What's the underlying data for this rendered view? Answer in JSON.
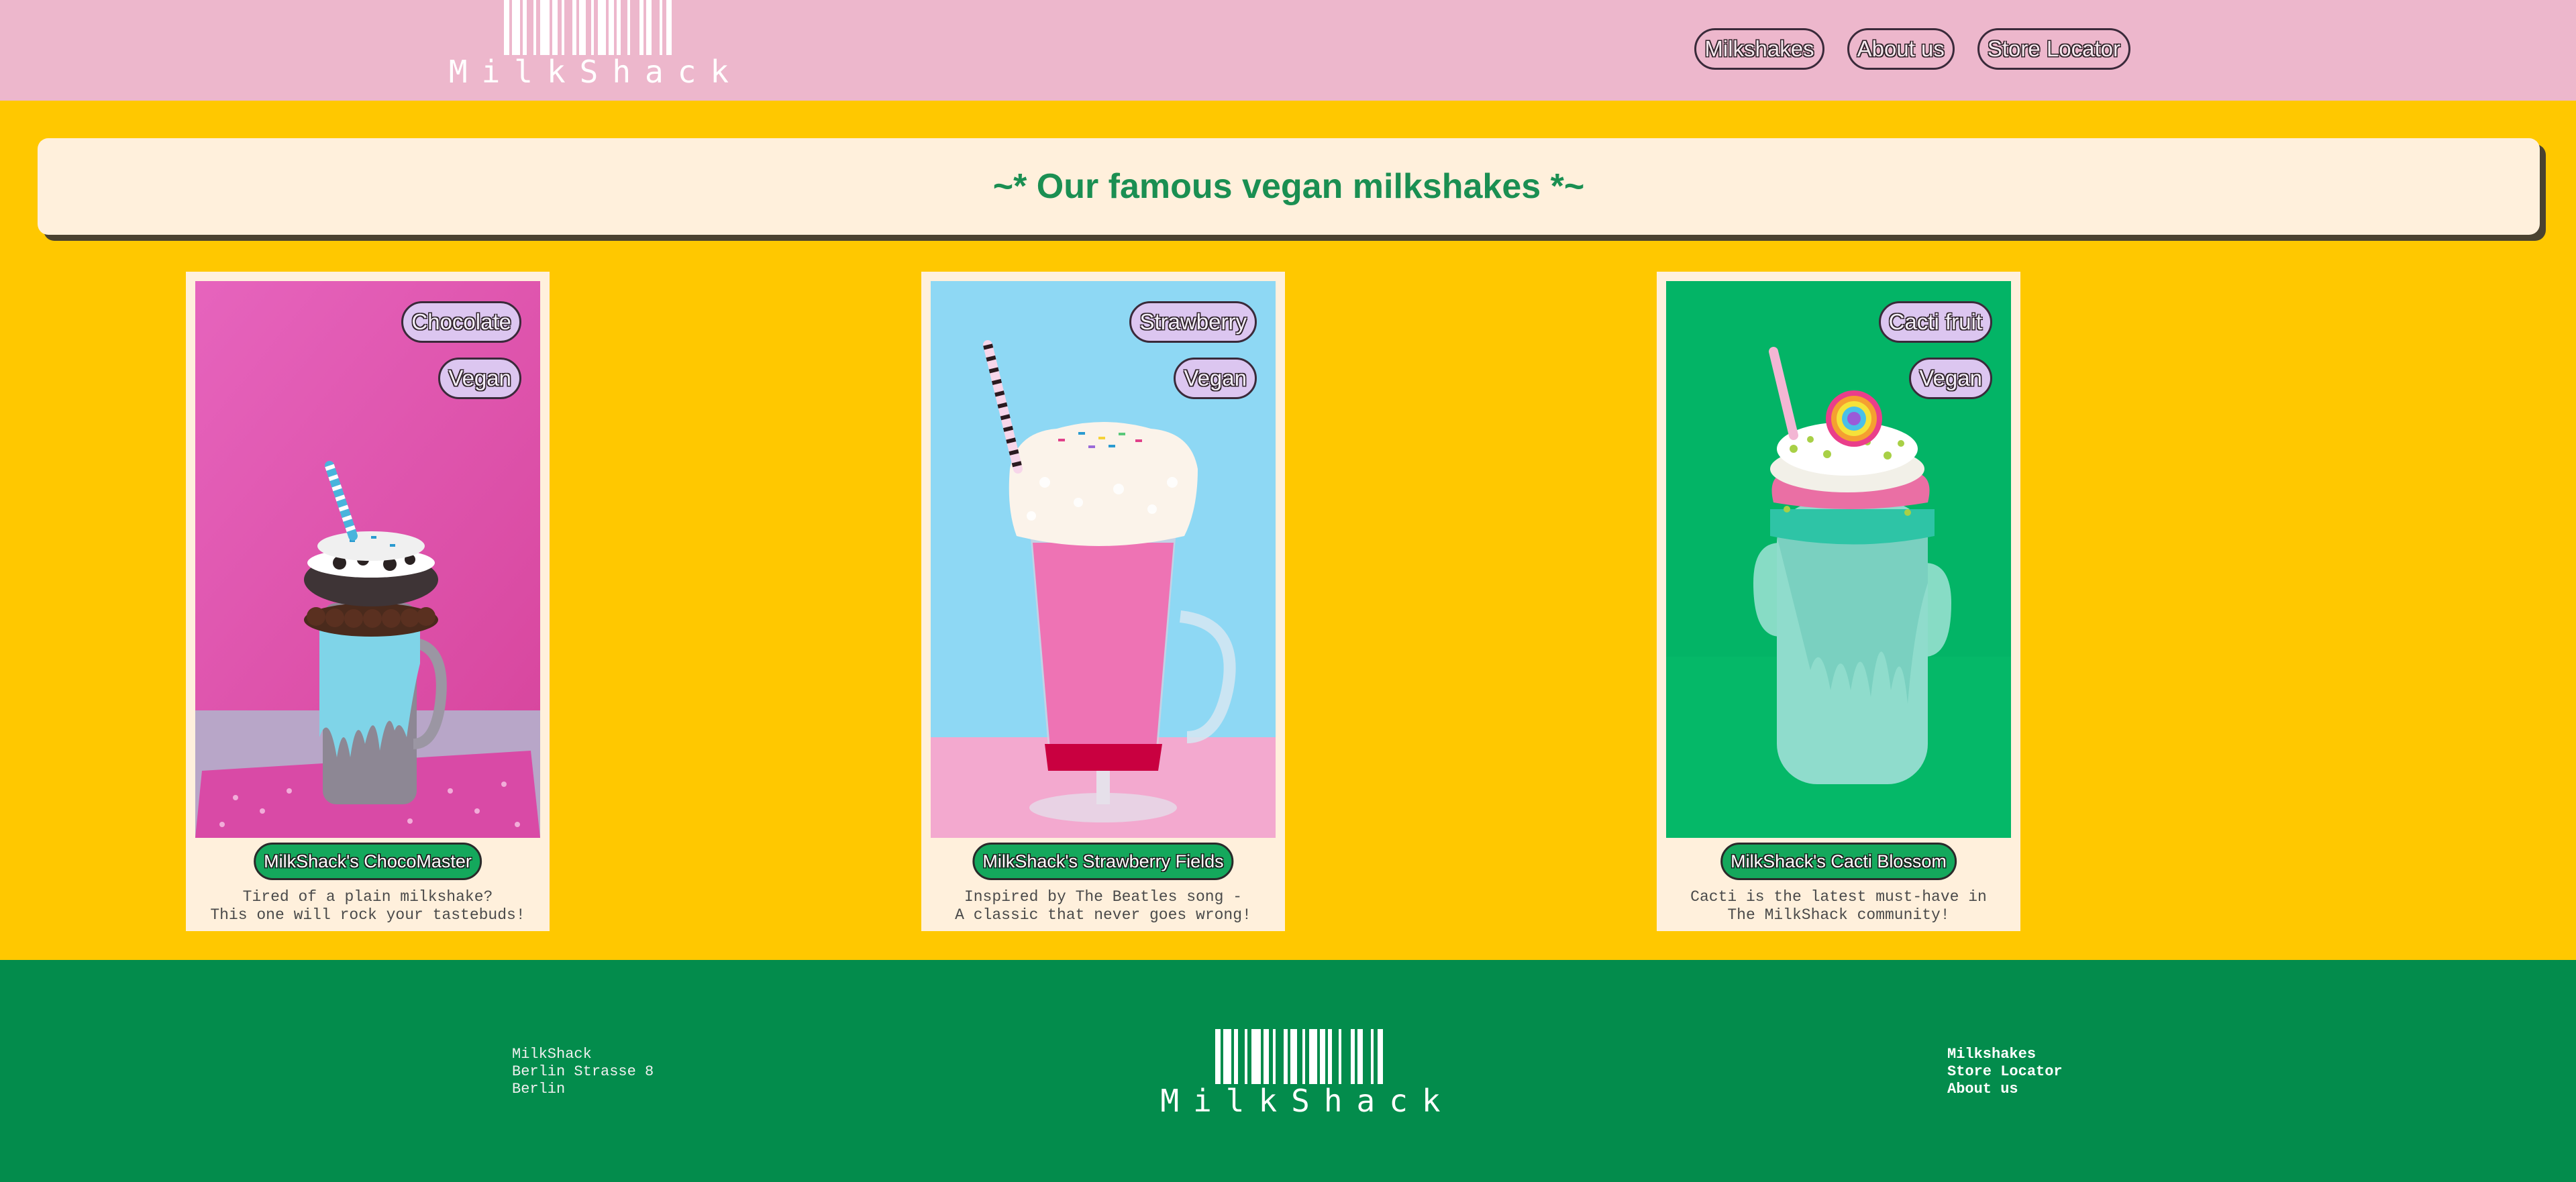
{
  "brand": {
    "name": "MilkShack"
  },
  "nav": {
    "items": [
      "Milkshakes",
      "About us",
      "Store Locator"
    ]
  },
  "banner": {
    "title": "~* Our famous vegan milkshakes *~"
  },
  "products": [
    {
      "tags": [
        "Chocolate",
        "Vegan"
      ],
      "name": "MilkShack's ChocoMaster",
      "description": [
        "Tired of a plain milkshake?",
        "This one will rock your tastebuds!"
      ],
      "image": "chocolate-milkshake-photo"
    },
    {
      "tags": [
        "Strawberry",
        "Vegan"
      ],
      "name": "MilkShack's Strawberry Fields",
      "description": [
        "Inspired by The Beatles song -",
        "A classic that never goes wrong!"
      ],
      "image": "strawberry-milkshake-photo"
    },
    {
      "tags": [
        "Cacti fruit",
        "Vegan"
      ],
      "name": "MilkShack's Cacti Blossom",
      "description": [
        "Cacti is the latest must-have in",
        "The MilkShack community!"
      ],
      "image": "cacti-milkshake-photo"
    }
  ],
  "footer": {
    "address": [
      "MilkShack",
      "Berlin Strasse 8",
      "Berlin"
    ],
    "links": [
      "Milkshakes",
      "Store Locator",
      "About us"
    ]
  },
  "colors": {
    "header_bg": "#edb7cc",
    "page_bg": "#ffc800",
    "banner_bg": "#fff0dc",
    "banner_text": "#1a8f52",
    "tag_bg": "#dcc6f0",
    "name_button_bg": "#14a85c",
    "footer_bg": "#038c4c"
  }
}
